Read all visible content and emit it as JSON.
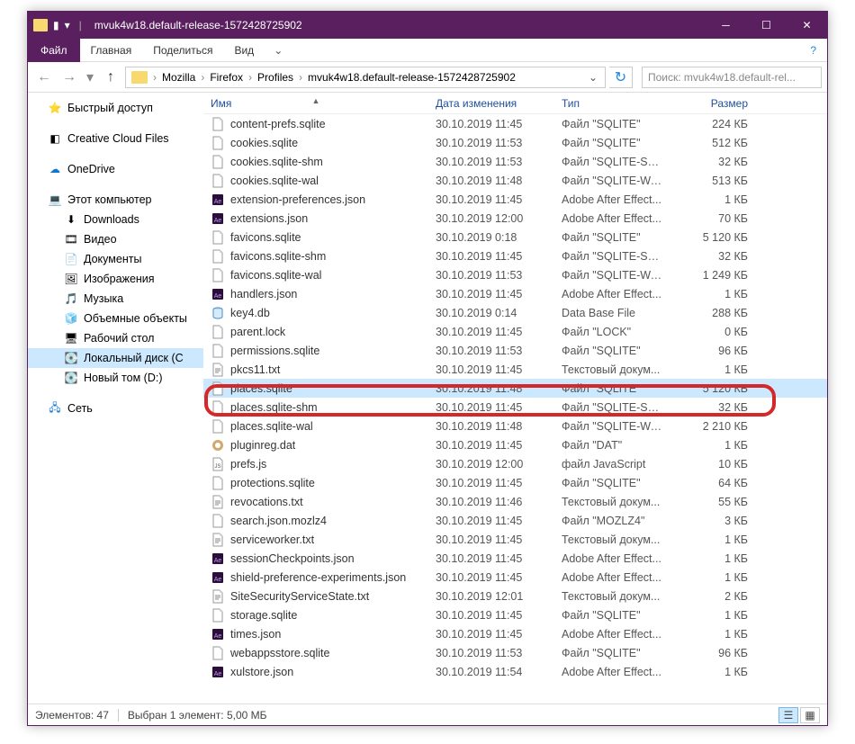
{
  "window_title": "mvuk4w18.default-release-1572428725902",
  "ribbon": {
    "file": "Файл",
    "home": "Главная",
    "share": "Поделиться",
    "view": "Вид"
  },
  "breadcrumbs": [
    "Mozilla",
    "Firefox",
    "Profiles",
    "mvuk4w18.default-release-1572428725902"
  ],
  "search_placeholder": "Поиск: mvuk4w18.default-rel...",
  "sidebar": {
    "quick_access": "Быстрый доступ",
    "creative_cloud": "Creative Cloud Files",
    "onedrive": "OneDrive",
    "this_pc": "Этот компьютер",
    "downloads": "Downloads",
    "videos": "Видео",
    "documents": "Документы",
    "pictures": "Изображения",
    "music": "Музыка",
    "objects3d": "Объемные объекты",
    "desktop": "Рабочий стол",
    "local_disk": "Локальный диск (C",
    "new_volume": "Новый том (D:)",
    "network": "Сеть"
  },
  "columns": {
    "name": "Имя",
    "date": "Дата изменения",
    "type": "Тип",
    "size": "Размер"
  },
  "files": [
    {
      "name": "content-prefs.sqlite",
      "date": "30.10.2019 11:45",
      "type": "Файл \"SQLITE\"",
      "size": "224 КБ",
      "icon": "file"
    },
    {
      "name": "cookies.sqlite",
      "date": "30.10.2019 11:53",
      "type": "Файл \"SQLITE\"",
      "size": "512 КБ",
      "icon": "file"
    },
    {
      "name": "cookies.sqlite-shm",
      "date": "30.10.2019 11:53",
      "type": "Файл \"SQLITE-SH...",
      "size": "32 КБ",
      "icon": "file"
    },
    {
      "name": "cookies.sqlite-wal",
      "date": "30.10.2019 11:48",
      "type": "Файл \"SQLITE-WA...",
      "size": "513 КБ",
      "icon": "file"
    },
    {
      "name": "extension-preferences.json",
      "date": "30.10.2019 11:45",
      "type": "Adobe After Effect...",
      "size": "1 КБ",
      "icon": "ae"
    },
    {
      "name": "extensions.json",
      "date": "30.10.2019 12:00",
      "type": "Adobe After Effect...",
      "size": "70 КБ",
      "icon": "ae"
    },
    {
      "name": "favicons.sqlite",
      "date": "30.10.2019 0:18",
      "type": "Файл \"SQLITE\"",
      "size": "5 120 КБ",
      "icon": "file"
    },
    {
      "name": "favicons.sqlite-shm",
      "date": "30.10.2019 11:45",
      "type": "Файл \"SQLITE-SH...",
      "size": "32 КБ",
      "icon": "file"
    },
    {
      "name": "favicons.sqlite-wal",
      "date": "30.10.2019 11:53",
      "type": "Файл \"SQLITE-WA...",
      "size": "1 249 КБ",
      "icon": "file"
    },
    {
      "name": "handlers.json",
      "date": "30.10.2019 11:45",
      "type": "Adobe After Effect...",
      "size": "1 КБ",
      "icon": "ae"
    },
    {
      "name": "key4.db",
      "date": "30.10.2019 0:14",
      "type": "Data Base File",
      "size": "288 КБ",
      "icon": "db"
    },
    {
      "name": "parent.lock",
      "date": "30.10.2019 11:45",
      "type": "Файл \"LOCK\"",
      "size": "0 КБ",
      "icon": "file"
    },
    {
      "name": "permissions.sqlite",
      "date": "30.10.2019 11:53",
      "type": "Файл \"SQLITE\"",
      "size": "96 КБ",
      "icon": "file"
    },
    {
      "name": "pkcs11.txt",
      "date": "30.10.2019 11:45",
      "type": "Текстовый докум...",
      "size": "1 КБ",
      "icon": "txt"
    },
    {
      "name": "places.sqlite",
      "date": "30.10.2019 11:48",
      "type": "Файл \"SQLITE\"",
      "size": "5 120 КБ",
      "icon": "file",
      "selected": true
    },
    {
      "name": "places.sqlite-shm",
      "date": "30.10.2019 11:45",
      "type": "Файл \"SQLITE-SH...",
      "size": "32 КБ",
      "icon": "file"
    },
    {
      "name": "places.sqlite-wal",
      "date": "30.10.2019 11:48",
      "type": "Файл \"SQLITE-WA...",
      "size": "2 210 КБ",
      "icon": "file"
    },
    {
      "name": "pluginreg.dat",
      "date": "30.10.2019 11:45",
      "type": "Файл \"DAT\"",
      "size": "1 КБ",
      "icon": "dat"
    },
    {
      "name": "prefs.js",
      "date": "30.10.2019 12:00",
      "type": "файл JavaScript",
      "size": "10 КБ",
      "icon": "js"
    },
    {
      "name": "protections.sqlite",
      "date": "30.10.2019 11:45",
      "type": "Файл \"SQLITE\"",
      "size": "64 КБ",
      "icon": "file"
    },
    {
      "name": "revocations.txt",
      "date": "30.10.2019 11:46",
      "type": "Текстовый докум...",
      "size": "55 КБ",
      "icon": "txt"
    },
    {
      "name": "search.json.mozlz4",
      "date": "30.10.2019 11:45",
      "type": "Файл \"MOZLZ4\"",
      "size": "3 КБ",
      "icon": "file"
    },
    {
      "name": "serviceworker.txt",
      "date": "30.10.2019 11:45",
      "type": "Текстовый докум...",
      "size": "1 КБ",
      "icon": "txt"
    },
    {
      "name": "sessionCheckpoints.json",
      "date": "30.10.2019 11:45",
      "type": "Adobe After Effect...",
      "size": "1 КБ",
      "icon": "ae"
    },
    {
      "name": "shield-preference-experiments.json",
      "date": "30.10.2019 11:45",
      "type": "Adobe After Effect...",
      "size": "1 КБ",
      "icon": "ae"
    },
    {
      "name": "SiteSecurityServiceState.txt",
      "date": "30.10.2019 12:01",
      "type": "Текстовый докум...",
      "size": "2 КБ",
      "icon": "txt"
    },
    {
      "name": "storage.sqlite",
      "date": "30.10.2019 11:45",
      "type": "Файл \"SQLITE\"",
      "size": "1 КБ",
      "icon": "file"
    },
    {
      "name": "times.json",
      "date": "30.10.2019 11:45",
      "type": "Adobe After Effect...",
      "size": "1 КБ",
      "icon": "ae"
    },
    {
      "name": "webappsstore.sqlite",
      "date": "30.10.2019 11:53",
      "type": "Файл \"SQLITE\"",
      "size": "96 КБ",
      "icon": "file"
    },
    {
      "name": "xulstore.json",
      "date": "30.10.2019 11:54",
      "type": "Adobe After Effect...",
      "size": "1 КБ",
      "icon": "ae"
    }
  ],
  "status": {
    "count": "Элементов: 47",
    "selection": "Выбран 1 элемент: 5,00 МБ"
  }
}
